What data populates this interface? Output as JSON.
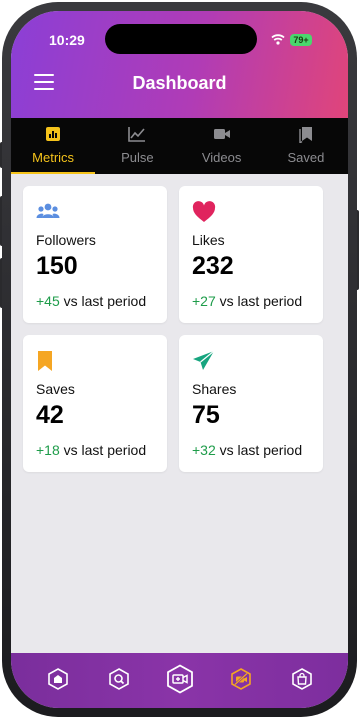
{
  "status": {
    "time": "10:29",
    "battery": "79+"
  },
  "header": {
    "title": "Dashboard"
  },
  "tabs": [
    {
      "label": "Metrics",
      "icon": "bar-chart-icon",
      "active": true
    },
    {
      "label": "Pulse",
      "icon": "line-chart-icon",
      "active": false
    },
    {
      "label": "Videos",
      "icon": "video-camera-icon",
      "active": false
    },
    {
      "label": "Saved",
      "icon": "bookmarks-icon",
      "active": false
    }
  ],
  "cards": [
    {
      "label": "Followers",
      "value": "150",
      "delta": "+45",
      "delta_suffix": " vs last period",
      "icon": "users-icon",
      "icon_color": "#5b8ee0"
    },
    {
      "label": "Likes",
      "value": "232",
      "delta": "+27",
      "delta_suffix": " vs last period",
      "icon": "heart-icon",
      "icon_color": "#e0245e"
    },
    {
      "label": "Saves",
      "value": "42",
      "delta": "+18",
      "delta_suffix": " vs last period",
      "icon": "bookmark-icon",
      "icon_color": "#f5a623"
    },
    {
      "label": "Shares",
      "value": "75",
      "delta": "+32",
      "delta_suffix": " vs last period",
      "icon": "send-icon",
      "icon_color": "#17a57f"
    }
  ],
  "bottom_nav": [
    {
      "icon": "home-icon",
      "active": false
    },
    {
      "icon": "search-icon",
      "active": false
    },
    {
      "icon": "add-video-icon",
      "active": false
    },
    {
      "icon": "no-camera-icon",
      "active": true
    },
    {
      "icon": "shopping-bag-icon",
      "active": false
    }
  ],
  "colors": {
    "accent": "#f5c31b",
    "positive": "#1e9c4a",
    "bottom_nav": "#8a34a8",
    "header_start": "#8b3fd6",
    "header_end": "#e0457a"
  }
}
